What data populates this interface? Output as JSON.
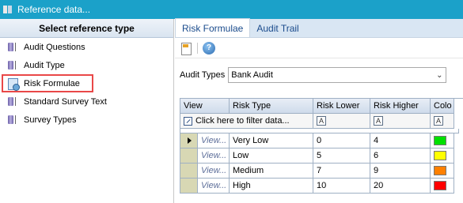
{
  "window": {
    "title": "Reference data..."
  },
  "left": {
    "header": "Select reference type",
    "items": [
      {
        "label": "Audit Questions",
        "icon": "database-icon"
      },
      {
        "label": "Audit Type",
        "icon": "database-icon"
      },
      {
        "label": "Risk Formulae",
        "icon": "formula-icon",
        "selected": true
      },
      {
        "label": "Standard Survey Text",
        "icon": "database-icon"
      },
      {
        "label": "Survey Types",
        "icon": "database-icon"
      }
    ]
  },
  "tabs": [
    {
      "label": "Risk Formulae",
      "active": true
    },
    {
      "label": "Audit Trail",
      "active": false
    }
  ],
  "toolbar": {
    "new_icon": "new-document-icon",
    "help_icon": "help-icon",
    "help_glyph": "?"
  },
  "filter": {
    "label": "Audit Types",
    "selected": "Bank Audit"
  },
  "grid": {
    "columns": [
      "View",
      "Risk Type",
      "Risk Lower",
      "Risk Higher",
      "Colo"
    ],
    "filter_placeholder": "Click here to filter data...",
    "filter_glyph": "A",
    "rows": [
      {
        "view": "View...",
        "type": "Very Low",
        "lower": "0",
        "higher": "4",
        "color": "#00e000",
        "current": true
      },
      {
        "view": "View...",
        "type": "Low",
        "lower": "5",
        "higher": "6",
        "color": "#ffff00",
        "current": false
      },
      {
        "view": "View...",
        "type": "Medium",
        "lower": "7",
        "higher": "9",
        "color": "#ff8000",
        "current": false
      },
      {
        "view": "View...",
        "type": "High",
        "lower": "10",
        "higher": "20",
        "color": "#ff0000",
        "current": false
      }
    ]
  }
}
